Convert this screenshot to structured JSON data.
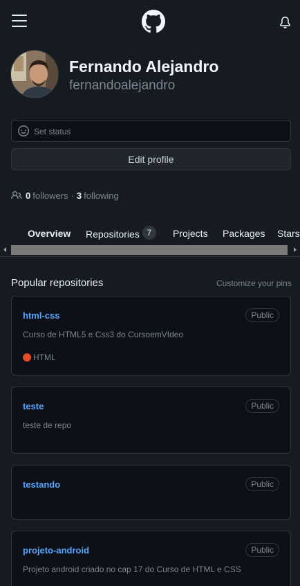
{
  "header": {
    "menu_icon": "hamburger-menu-icon",
    "logo_icon": "github-octocat-icon",
    "notifications_icon": "bell-icon"
  },
  "profile": {
    "display_name": "Fernando Alejandro",
    "username": "fernandoalejandro",
    "avatar": "profile-photo"
  },
  "status": {
    "label": "Set status",
    "icon": "smiley-icon"
  },
  "edit_profile_label": "Edit profile",
  "follow": {
    "icon": "people-icon",
    "followers_count": "0",
    "followers_label": "followers",
    "separator": "·",
    "following_count": "3",
    "following_label": "following"
  },
  "tabs": [
    {
      "label": "Overview",
      "selected": true
    },
    {
      "label": "Repositories",
      "count": "7"
    },
    {
      "label": "Projects"
    },
    {
      "label": "Packages"
    },
    {
      "label": "Stars"
    }
  ],
  "popular": {
    "title": "Popular repositories",
    "customize_label": "Customize your pins",
    "repos": [
      {
        "name": "html-css",
        "visibility": "Public",
        "description": "Curso de HTML5 e Css3 do CursoemVIdeo",
        "language": "HTML",
        "language_color": "#e34c26"
      },
      {
        "name": "teste",
        "visibility": "Public",
        "description": "teste de repo"
      },
      {
        "name": "testando",
        "visibility": "Public"
      },
      {
        "name": "projeto-android",
        "visibility": "Public",
        "description": "Projeto android criado no cap 17 do Curso de HTML e CSS"
      }
    ]
  },
  "colors": {
    "background": "#0d1117",
    "surface": "#161b22",
    "border": "#30363d",
    "link": "#58a6ff",
    "muted": "#7d8590"
  }
}
